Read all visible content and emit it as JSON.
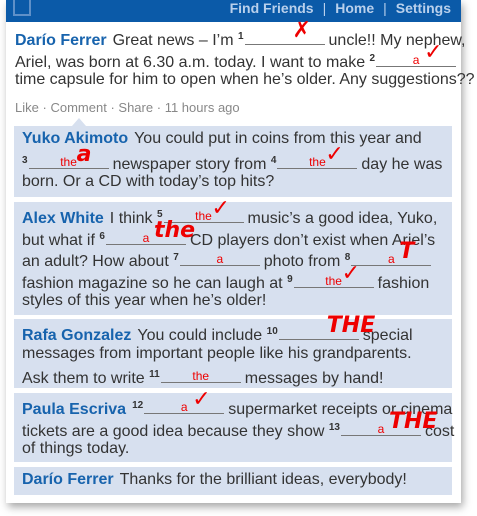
{
  "nav": {
    "find_friends": "Find Friends",
    "home": "Home",
    "settings": "Settings",
    "sep": "|"
  },
  "meta": {
    "like": "Like",
    "comment": "Comment",
    "share": "Share",
    "time": "11 hours ago",
    "dot": "·"
  },
  "posts": [
    {
      "name": "Darío Ferrer",
      "lines": [
        [
          {
            "t": "Great news – I’m "
          },
          {
            "n": "1",
            "a": "",
            "m": "✗"
          },
          {
            "t": "uncle!! My nephew,"
          }
        ],
        [
          {
            "t": "Ariel, was born at 6.30 a.m. today. I want to make "
          },
          {
            "n": "2",
            "a": "a",
            "m": "✓"
          }
        ],
        [
          {
            "t": "time capsule for him to open when he’s older. Any suggestions??"
          }
        ]
      ]
    },
    {
      "name": "Yuko Akimoto",
      "lines": [
        [
          {
            "t": "You could put in coins from this year and"
          }
        ],
        [
          {
            "n": "3",
            "a": "the",
            "m": "a"
          },
          {
            "t": "newspaper story from "
          },
          {
            "n": "4",
            "a": "the",
            "m": "✓"
          },
          {
            "t": "day he was"
          }
        ],
        [
          {
            "t": "born. Or a CD with today’s top hits?"
          }
        ]
      ]
    },
    {
      "name": "Alex White",
      "lines": [
        [
          {
            "t": "I think "
          },
          {
            "n": "5",
            "a": "the",
            "m": "✓"
          },
          {
            "t": "music’s a good idea, Yuko,"
          }
        ],
        [
          {
            "t": "but what if "
          },
          {
            "n": "6",
            "a": "a",
            "m": "the"
          },
          {
            "t": "CD players don’t exist when Ariel’s"
          }
        ],
        [
          {
            "t": "an adult? How about "
          },
          {
            "n": "7",
            "a": "a",
            "m": ""
          },
          {
            "t": "photo from "
          },
          {
            "n": "8",
            "a": "a",
            "m": "T"
          }
        ],
        [
          {
            "t": "fashion magazine so he can laugh at "
          },
          {
            "n": "9",
            "a": "the",
            "m": "✓"
          },
          {
            "t": "fashion"
          }
        ],
        [
          {
            "t": "styles of this year when he’s older!"
          }
        ]
      ]
    },
    {
      "name": "Rafa Gonzalez",
      "lines": [
        [
          {
            "t": "You could include "
          },
          {
            "n": "10",
            "a": "",
            "m": "THE"
          },
          {
            "t": "special"
          }
        ],
        [
          {
            "t": "messages from important people like his grandparents."
          }
        ],
        [
          {
            "t": "Ask them to write "
          },
          {
            "n": "11",
            "a": "the",
            "m": ""
          },
          {
            "t": "messages by hand!"
          }
        ]
      ]
    },
    {
      "name": "Paula Escriva",
      "lines": [
        [
          {
            "n": "12",
            "a": "a",
            "m": "✓"
          },
          {
            "t": "supermarket receipts or cinema"
          }
        ],
        [
          {
            "t": "tickets are a good idea because they show "
          },
          {
            "n": "13",
            "a": "a",
            "m": "THE"
          },
          {
            "t": "cost"
          }
        ],
        [
          {
            "t": "of things today."
          }
        ]
      ]
    },
    {
      "name": "Darío Ferrer",
      "lines": [
        [
          {
            "t": "Thanks for the brilliant ideas, everybody!"
          }
        ]
      ]
    }
  ],
  "colors": {
    "header": "#0b5aa8",
    "name": "#1763ad",
    "comment_bg": "#d7e0ef",
    "correction": "#e00000"
  }
}
